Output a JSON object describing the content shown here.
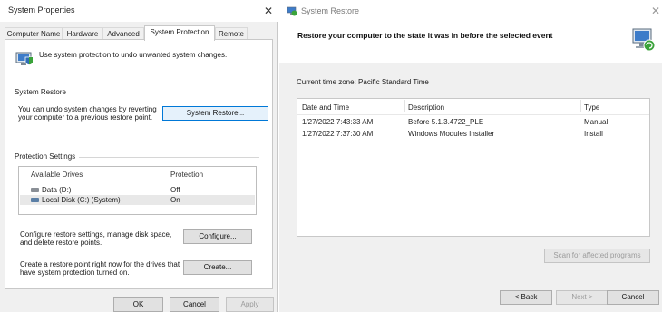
{
  "props": {
    "title": "System Properties",
    "close": "✕",
    "tabs": [
      "Computer Name",
      "Hardware",
      "Advanced",
      "System Protection",
      "Remote"
    ],
    "intro": "Use system protection to undo unwanted system changes.",
    "restore_group": {
      "title": "System Restore",
      "desc_line1": "You can undo system changes by reverting",
      "desc_line2": "your computer to a previous restore point.",
      "button": "System Restore..."
    },
    "protection_group": {
      "title": "Protection Settings",
      "col_drives": "Available Drives",
      "col_protection": "Protection",
      "drives": [
        {
          "name": "Data (D:)",
          "protection": "Off",
          "icon": "drive-icon"
        },
        {
          "name": "Local Disk (C:) (System)",
          "protection": "On",
          "icon": "windows-drive-icon"
        }
      ],
      "configure_text_line1": "Configure restore settings, manage disk space,",
      "configure_text_line2": "and delete restore points.",
      "configure_button": "Configure...",
      "create_text_line1": "Create a restore point right now for the drives that",
      "create_text_line2": "have system protection turned on.",
      "create_button": "Create..."
    },
    "footer": {
      "ok": "OK",
      "cancel": "Cancel",
      "apply": "Apply"
    }
  },
  "restore": {
    "title": "System Restore",
    "close": "✕",
    "heading": "Restore your computer to the state it was in before the selected event",
    "timezone": "Current time zone: Pacific Standard Time",
    "columns": {
      "date": "Date and Time",
      "description": "Description",
      "type": "Type"
    },
    "rows": [
      {
        "date": "1/27/2022 7:43:33 AM",
        "description": "Before 5.1.3.4722_PLE",
        "type": "Manual"
      },
      {
        "date": "1/27/2022 7:37:30 AM",
        "description": "Windows Modules Installer",
        "type": "Install"
      }
    ],
    "scan_button": "Scan for affected programs",
    "back_button": "< Back",
    "next_button": "Next >",
    "cancel_button": "Cancel"
  },
  "colors": {
    "accent": "#0078d7",
    "shield_blue": "#2f6db5",
    "shield_green": "#3aa33a"
  }
}
